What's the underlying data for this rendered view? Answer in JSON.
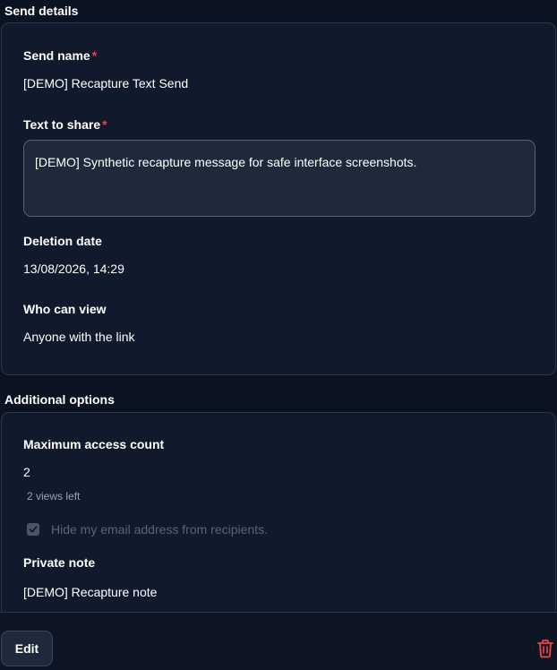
{
  "send_details": {
    "title": "Send details",
    "send_name": {
      "label": "Send name",
      "required_mark": "*",
      "value": "[DEMO] Recapture Text Send"
    },
    "text_to_share": {
      "label": "Text to share",
      "required_mark": "*",
      "value": "[DEMO] Synthetic recapture message for safe interface screenshots."
    },
    "deletion_date": {
      "label": "Deletion date",
      "value": "13/08/2026, 14:29"
    },
    "who_can_view": {
      "label": "Who can view",
      "value": "Anyone with the link"
    }
  },
  "additional_options": {
    "title": "Additional options",
    "max_access_count": {
      "label": "Maximum access count",
      "value": "2",
      "hint": "2 views left"
    },
    "hide_email": {
      "label": "Hide my email address from recipients.",
      "checked": true,
      "disabled": true
    },
    "private_note": {
      "label": "Private note",
      "value": "[DEMO] Recapture note"
    }
  },
  "footer": {
    "edit_label": "Edit",
    "delete_icon": "trash-icon"
  },
  "colors": {
    "background": "#0b1221",
    "card": "#111a2c",
    "required": "#ef4444",
    "delete": "#ef4444"
  }
}
